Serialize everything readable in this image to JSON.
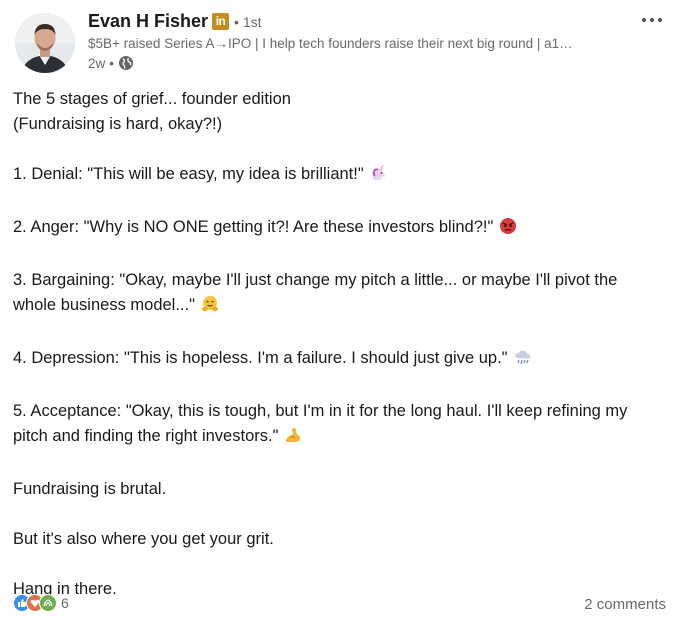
{
  "author": {
    "name": "Evan H Fisher",
    "badge": "in",
    "degree": "• 1st",
    "headline": "$5B+ raised Series A→IPO | I help tech founders raise their next big round | a1…",
    "time": "2w",
    "separator": "•",
    "visibility_icon": "globe-icon"
  },
  "post": {
    "lines": [
      "The 5 stages of grief... founder edition",
      "(Fundraising is hard, okay?!)",
      "1. Denial: \"This will be easy, my idea is brilliant!\"",
      "2. Anger: \"Why is NO ONE getting it?! Are these investors blind?!\"",
      "3. Bargaining: \"Okay, maybe I'll just change my pitch a little... or maybe I'll pivot the whole business model...\"",
      "4. Depression: \"This is hopeless. I'm a failure. I should just give up.\"",
      "5. Acceptance: \"Okay, this is tough, but I'm in it for the long haul. I'll keep refining my pitch and finding the right investors.\"",
      "Fundraising is brutal.",
      "But it's also where you get your grit.",
      "Hang in there."
    ],
    "emojis": [
      "unicorn-emoji",
      "angry-face-emoji",
      "hugging-face-emoji",
      "rain-cloud-emoji",
      "flexed-biceps-emoji"
    ]
  },
  "footer": {
    "reaction_icons": [
      "like-icon",
      "love-icon",
      "support-icon"
    ],
    "reaction_count": "6",
    "comments": "2 comments"
  },
  "colors": {
    "like": "#378fe9",
    "love": "#df704d",
    "support": "#6dae4f",
    "badge": "#c58c1f"
  }
}
